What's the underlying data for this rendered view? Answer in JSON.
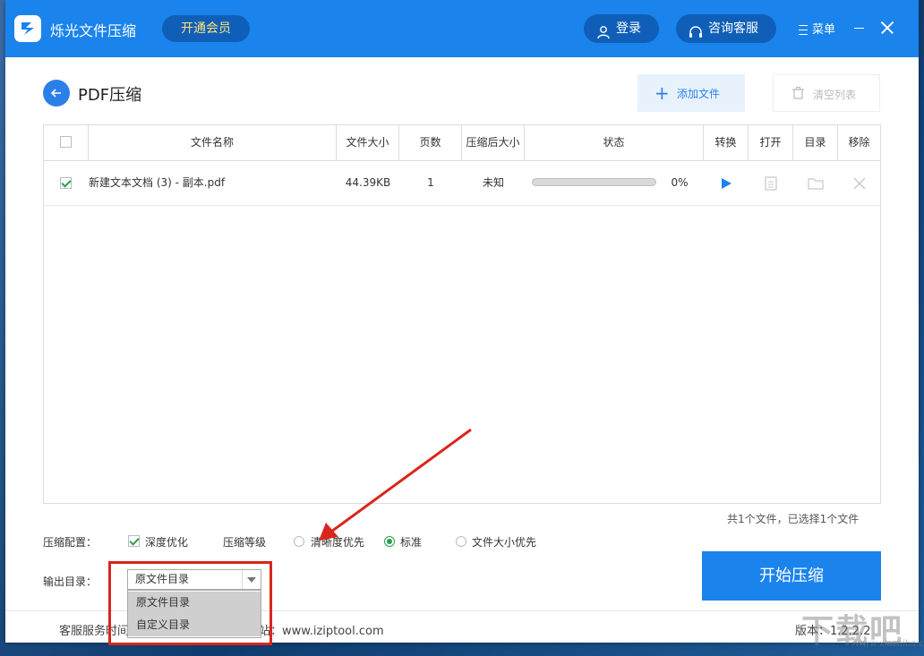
{
  "app": {
    "title": "烁光文件压缩",
    "vip_label": "开通会员",
    "login_label": "登录",
    "service_label": "咨询客服",
    "menu_label": "菜单"
  },
  "page": {
    "title": "PDF压缩",
    "add_file_label": "添加文件",
    "clear_list_label": "清空列表"
  },
  "table": {
    "headers": [
      "文件名称",
      "文件大小",
      "页数",
      "压缩后大小",
      "状态",
      "转换",
      "打开",
      "目录",
      "移除"
    ],
    "rows": [
      {
        "checked": true,
        "name": "新建文本文档 (3) - 副本.pdf",
        "size": "44.39KB",
        "pages": "1",
        "compressed_size": "未知",
        "progress": 0,
        "progress_text": "0%"
      }
    ]
  },
  "summary": "共1个文件，已选择1个文件",
  "settings": {
    "config_label": "压缩配置：",
    "deep_optimize_label": "深度优化",
    "deep_optimize_checked": true,
    "level_label": "压缩等级",
    "levels": [
      {
        "label": "清晰度优先",
        "selected": false
      },
      {
        "label": "标准",
        "selected": true
      },
      {
        "label": "文件大小优先",
        "selected": false
      }
    ],
    "output_label": "输出目录：",
    "output_selected": "原文件目录",
    "output_options": [
      "原文件目录",
      "自定义目录"
    ]
  },
  "start_label": "开始压缩",
  "footer": {
    "left_text": "客服服务时间",
    "right_text": "站：www.iziptool.com",
    "version": "版本：1.2.2.2"
  },
  "watermark": {
    "text": "下载吧",
    "url": "www.xiazaiba.com"
  },
  "colors": {
    "primary": "#1a83ec",
    "highlight": "#d9261c",
    "check": "#2aa04a"
  }
}
